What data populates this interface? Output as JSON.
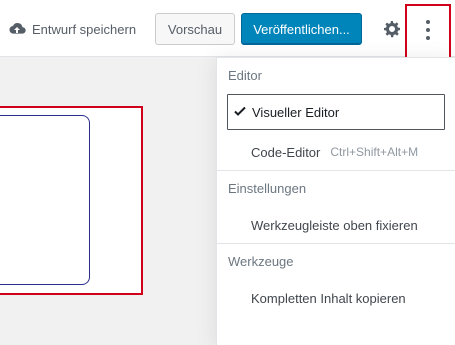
{
  "header": {
    "save_draft": "Entwurf speichern",
    "preview": "Vorschau",
    "publish": "Veröffentlichen...",
    "settings_icon": "gear-icon",
    "more_icon": "vertical-ellipsis-icon"
  },
  "menu": {
    "groups": [
      {
        "title": "Editor",
        "items": [
          {
            "label": "Visueller Editor",
            "active": true,
            "icon": "check-icon"
          },
          {
            "label": "Code-Editor",
            "shortcut": "Ctrl+Shift+Alt+M"
          }
        ]
      },
      {
        "title": "Einstellungen",
        "items": [
          {
            "label": "Werkzeugleiste oben fixieren"
          }
        ]
      },
      {
        "title": "Werkzeuge",
        "items": [
          {
            "label": "Kompletten Inhalt kopieren"
          }
        ]
      }
    ]
  },
  "colors": {
    "primary": "#0085ba",
    "highlight": "#d0021b",
    "text": "#555d66"
  }
}
